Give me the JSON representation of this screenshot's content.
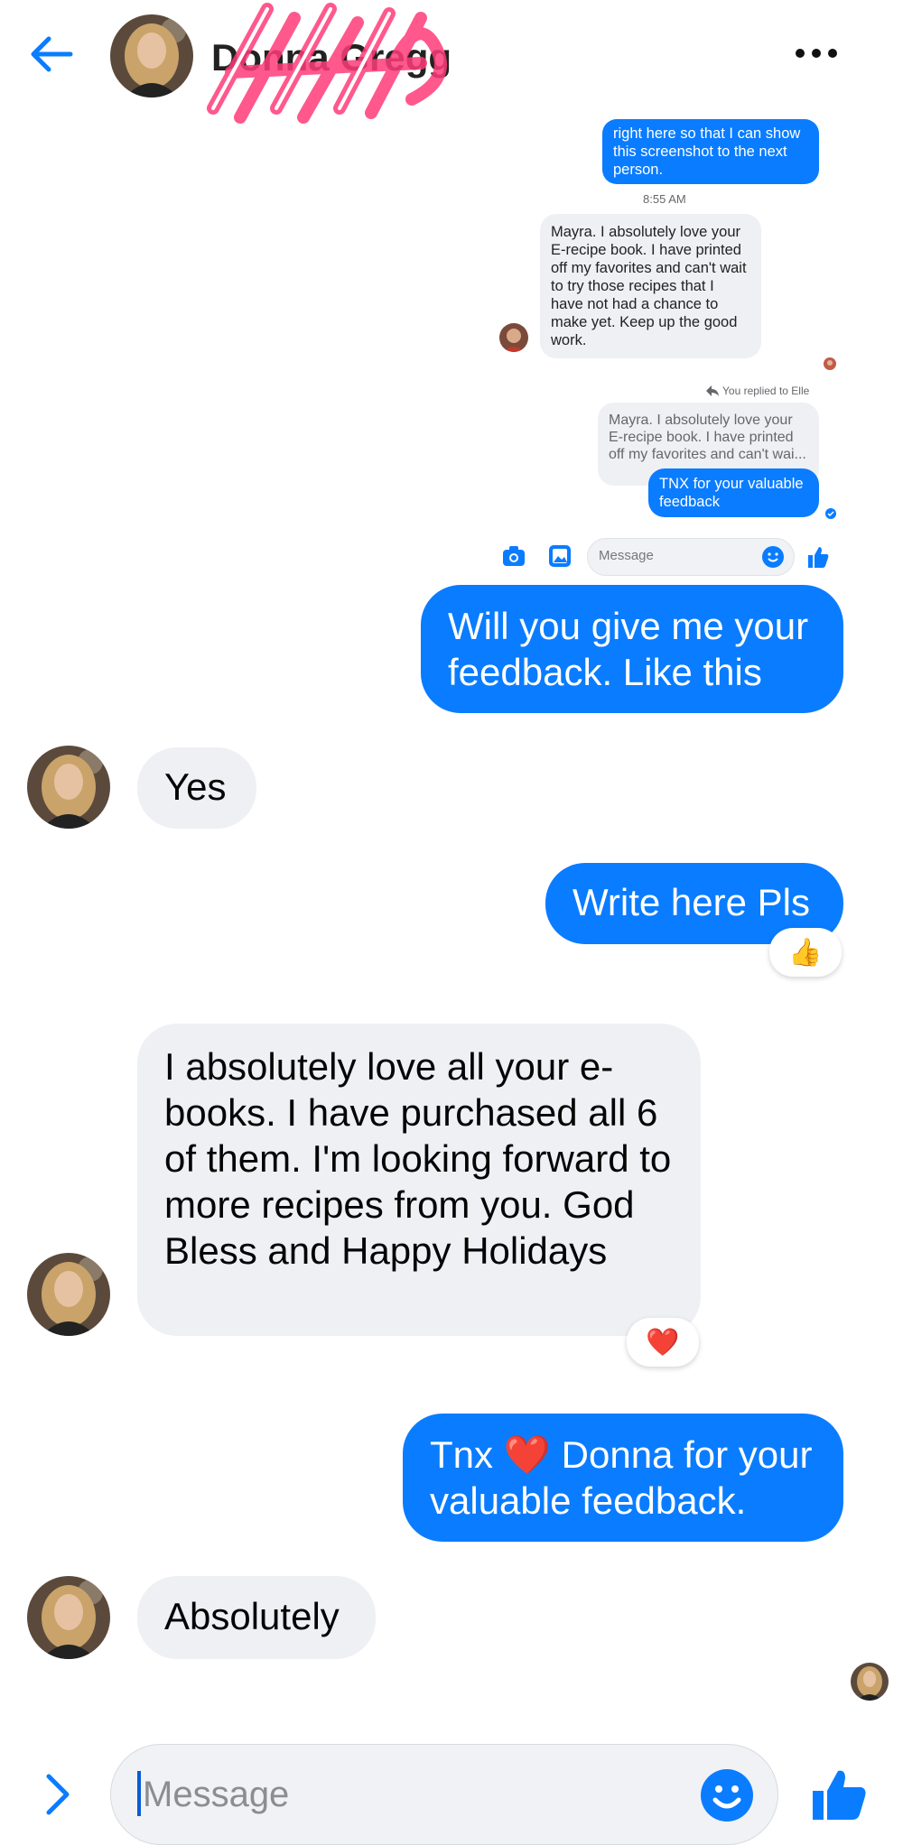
{
  "header": {
    "contact_name": "Donna Gregg",
    "back_icon": "arrow-left-icon",
    "more_icon": "more-horizontal-icon"
  },
  "embedded_screenshot": {
    "prev_message": "right here so that I can show this screenshot to the next person.",
    "timestamp": "8:55 AM",
    "review_message": "Mayra. I absolutely love your E-recipe book.  I have printed off my favorites and can't wait to try those recipes that I have not had a chance to make yet. Keep up the good work.",
    "replied_label": "You replied to Elle",
    "quoted_message": "Mayra. I absolutely love your E-recipe book.  I have printed off my favorites and can't wai...",
    "reply_message": "TNX for your valuable feedback",
    "input_placeholder": "Message"
  },
  "messages": [
    {
      "direction": "out",
      "text": "Will you give me your feedback. Like this"
    },
    {
      "direction": "in",
      "text": "Yes"
    },
    {
      "direction": "out",
      "text": "Write here Pls",
      "reaction": "👍"
    },
    {
      "direction": "in",
      "text": "I absolutely love all your e-books. I have purchased all 6 of them. I'm looking forward to more recipes from you. God Bless and Happy Holidays",
      "reaction": "❤️"
    },
    {
      "direction": "out",
      "text": "Tnx ❤️ Donna for your valuable feedback."
    },
    {
      "direction": "in",
      "text": "Absolutely"
    }
  ],
  "composer": {
    "placeholder": "Message",
    "expand_icon": "chevron-right-icon",
    "emoji_icon": "smiley-icon",
    "like_icon": "thumbs-up-icon"
  },
  "colors": {
    "accent": "#0a7cff",
    "incoming_bubble": "#eff0f4"
  }
}
